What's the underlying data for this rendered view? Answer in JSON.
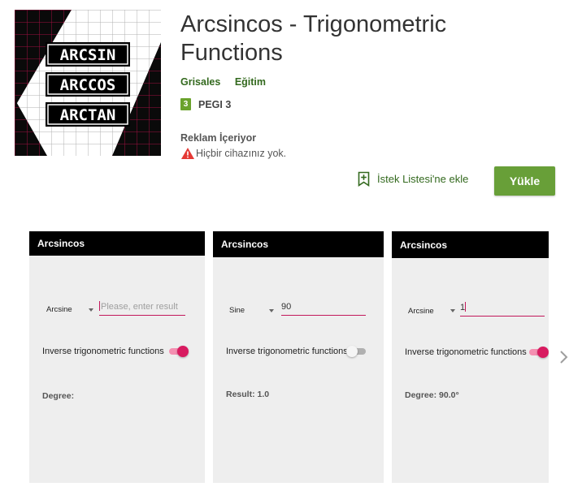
{
  "app": {
    "title": "Arcsincos - Trigonometric Functions",
    "developer": "Grisales",
    "category": "Eğitim",
    "rating": "PEGI 3",
    "rating_badge": "3",
    "ads_label": "Reklam İçeriyor",
    "device_warning": "Hiçbir cihazınız yok.",
    "icon_lines": [
      "ARCSIN",
      "ARCCOS",
      "ARCTAN"
    ]
  },
  "actions": {
    "wishlist_label": "İstek Listesi'ne ekle",
    "install_label": "Yükle"
  },
  "colors": {
    "accent_green": "#689f38",
    "text_green": "#33691e",
    "pink_accent": "#d81b60",
    "warning_red": "#e53935"
  },
  "screenshots": [
    {
      "app_bar_title": "Arcsincos",
      "function_select": "Arcsine",
      "input_value": "",
      "input_placeholder": "Please, enter result",
      "switch_label": "Inverse trigonometric functions",
      "switch_on": true,
      "output_text": "Degree:"
    },
    {
      "app_bar_title": "Arcsincos",
      "function_select": "Sine",
      "input_value": "90",
      "input_placeholder": "",
      "switch_label": "Inverse trigonometric functions",
      "switch_on": false,
      "output_text": "Result: 1.0"
    },
    {
      "app_bar_title": "Arcsincos",
      "function_select": "Arcsine",
      "input_value": "1",
      "input_placeholder": "",
      "switch_label": "Inverse trigonometric functions",
      "switch_on": true,
      "output_text": "Degree: 90.0°"
    }
  ]
}
